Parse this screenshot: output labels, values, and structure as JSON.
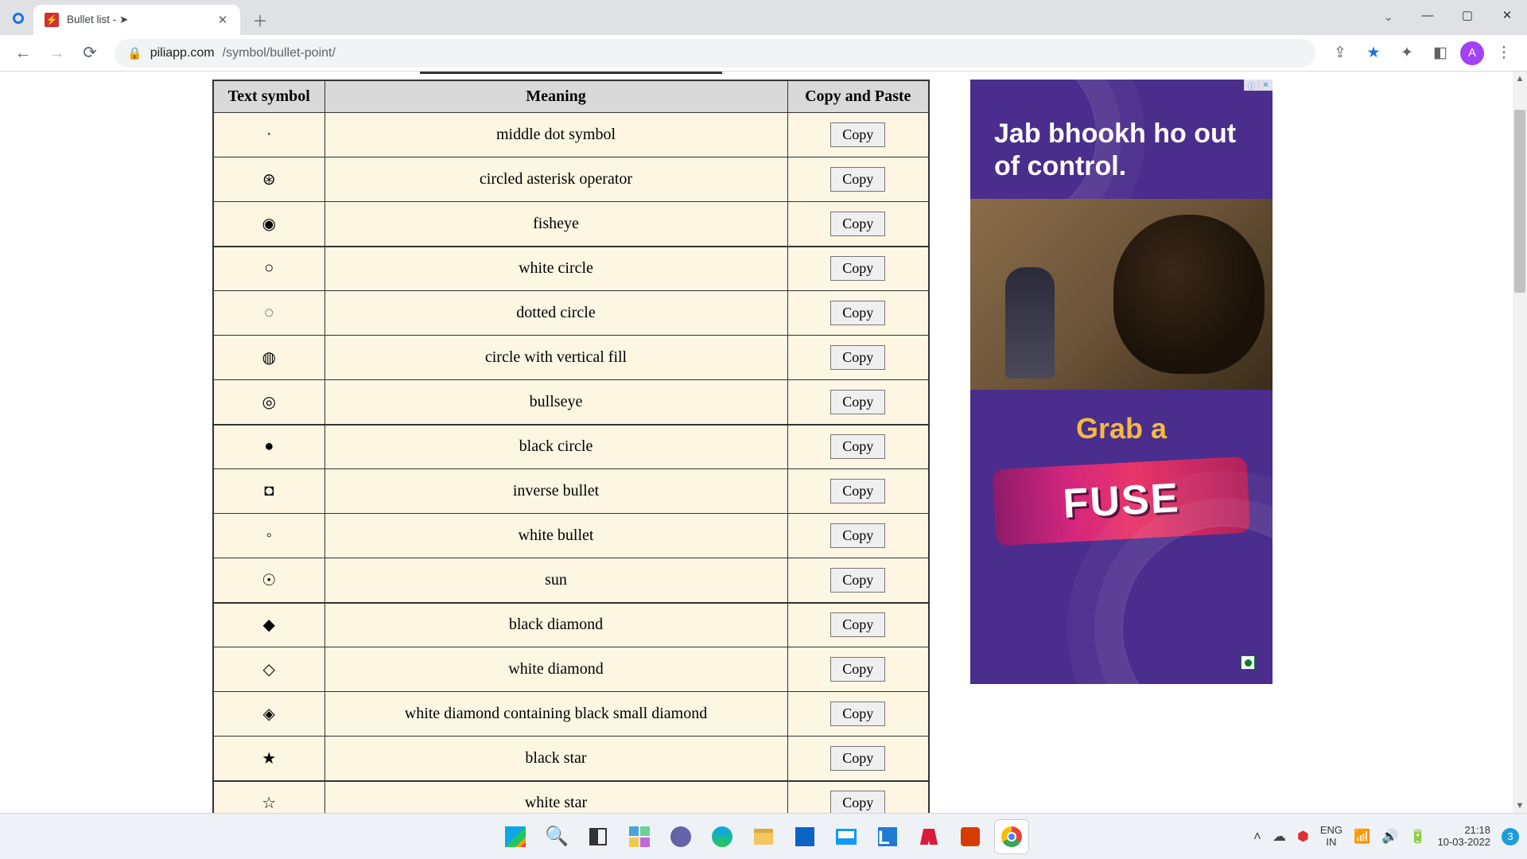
{
  "browser": {
    "tab_title": "Bullet list - ➤",
    "url_host": "piliapp.com",
    "url_path": "/symbol/bullet-point/",
    "avatar_initial": "A"
  },
  "table": {
    "headers": [
      "Text symbol",
      "Meaning",
      "Copy and Paste"
    ],
    "copy_label": "Copy",
    "rows": [
      {
        "symbol": "·",
        "meaning": "middle dot symbol"
      },
      {
        "symbol": "⊛",
        "meaning": "circled asterisk operator"
      },
      {
        "symbol": "◉",
        "meaning": "fisheye"
      },
      {
        "symbol": "○",
        "meaning": "white circle"
      },
      {
        "symbol": "◌",
        "meaning": "dotted circle"
      },
      {
        "symbol": "◍",
        "meaning": "circle with vertical fill"
      },
      {
        "symbol": "◎",
        "meaning": "bullseye"
      },
      {
        "symbol": "●",
        "meaning": "black circle"
      },
      {
        "symbol": "◘",
        "meaning": "inverse bullet"
      },
      {
        "symbol": "◦",
        "meaning": "white bullet"
      },
      {
        "symbol": "☉",
        "meaning": "sun"
      },
      {
        "symbol": "◆",
        "meaning": "black diamond"
      },
      {
        "symbol": "◇",
        "meaning": "white diamond"
      },
      {
        "symbol": "◈",
        "meaning": "white diamond containing black small diamond"
      },
      {
        "symbol": "★",
        "meaning": "black star"
      },
      {
        "symbol": "☆",
        "meaning": "white star"
      }
    ]
  },
  "ad": {
    "headline": "Jab bhookh ho out of control.",
    "grab": "Grab a",
    "product": "FUSE"
  },
  "tray": {
    "lang_top": "ENG",
    "lang_bot": "IN",
    "time": "21:18",
    "date": "10-03-2022",
    "notif_count": "3"
  }
}
